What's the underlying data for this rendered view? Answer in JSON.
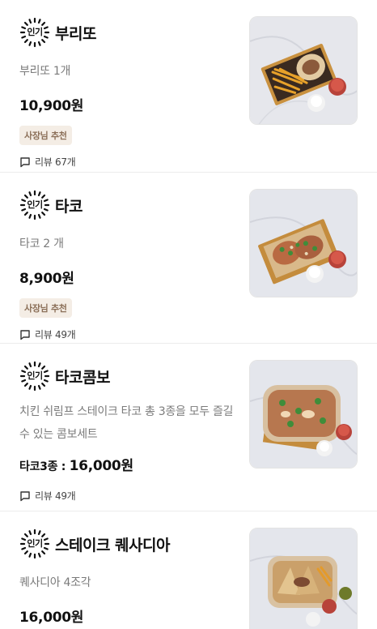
{
  "badge_text": "인기",
  "items": [
    {
      "name": "부리또",
      "description": "부리또 1개",
      "price": "10,900원",
      "tag": "사장님 추천",
      "review": "리뷰 67개"
    },
    {
      "name": "타코",
      "description": "타코 2 개",
      "price": "8,900원",
      "tag": "사장님 추천",
      "review": "리뷰 49개"
    },
    {
      "name": "타코콤보",
      "description": "치킨 쉬림프 스테이크 타코 총 3종을 모두 즐길수 있는 콤보세트",
      "price_prefix": "타코3종 : ",
      "price": "16,000원",
      "review": "리뷰 49개"
    },
    {
      "name": "스테이크 퀘사디아",
      "description": "퀘사디아 4조각",
      "price": "16,000원"
    }
  ]
}
